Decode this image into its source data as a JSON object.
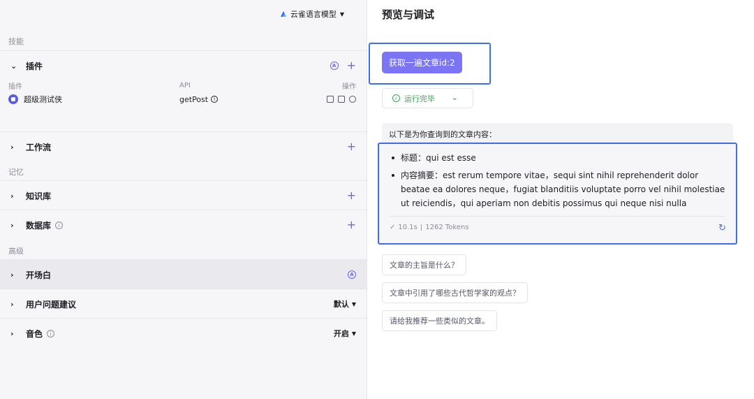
{
  "left_panel": {
    "model_selector": {
      "label": "云雀语言模型"
    },
    "groups": {
      "skills": "技能",
      "memory": "记忆",
      "advanced": "高级"
    },
    "plugins": {
      "title": "插件",
      "columns": {
        "plugin": "插件",
        "api": "API",
        "ops": "操作"
      },
      "rows": [
        {
          "name": "超级测试侠",
          "api": "getPost"
        }
      ]
    },
    "workflow": {
      "title": "工作流"
    },
    "knowledge": {
      "title": "知识库"
    },
    "database": {
      "title": "数据库"
    },
    "opening": {
      "title": "开场白"
    },
    "suggestions": {
      "title": "用户问题建议",
      "value": "默认"
    },
    "voice": {
      "title": "音色",
      "value": "开启"
    }
  },
  "right_panel": {
    "title": "预览与调试",
    "user_message": "获取一遍文章id:2",
    "run_status": "运行完毕",
    "answer": {
      "intro": "以下是为你查询到的文章内容：",
      "items": [
        "标题：qui est esse",
        "内容摘要：est rerum tempore vitae，sequi sint nihil reprehenderit dolor beatae ea dolores neque，fugiat blanditiis voluptate porro vel nihil molestiae ut reiciendis，qui aperiam non debitis possimus qui neque nisi nulla"
      ],
      "duration": "10.1s",
      "tokens": "1262 Tokens"
    },
    "suggested_questions": [
      "文章的主旨是什么？",
      "文章中引用了哪些古代哲学家的观点？",
      "请给我推荐一些类似的文章。"
    ]
  },
  "colors": {
    "accent": "#6d63f3",
    "highlight_border": "#3d6df2",
    "success": "#32a852"
  }
}
